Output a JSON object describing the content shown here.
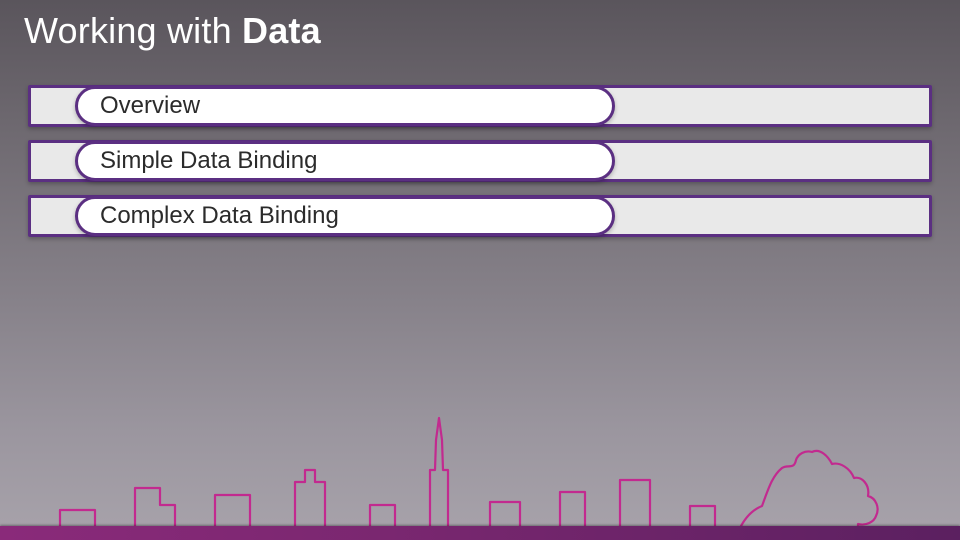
{
  "title_prefix": "Working with ",
  "title_suffix": "Data",
  "items": [
    {
      "label": "Overview"
    },
    {
      "label": "Simple Data Binding"
    },
    {
      "label": "Complex Data Binding"
    }
  ],
  "colors": {
    "accent_purple": "#5b2f82",
    "magenta": "#c22a8f",
    "bar_bg": "#e9e9e9",
    "pill_bg": "#ffffff"
  }
}
